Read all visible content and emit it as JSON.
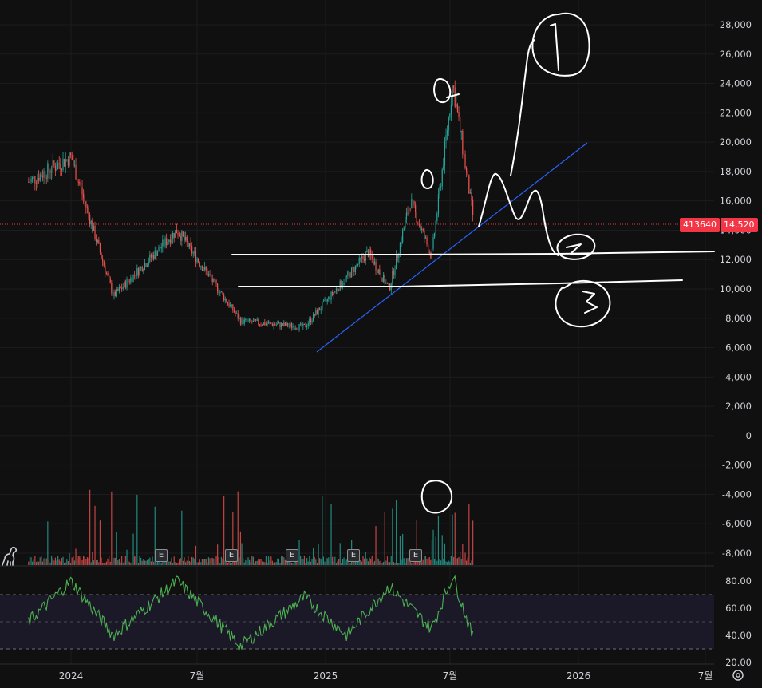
{
  "price_axis": {
    "labels": [
      "28,000",
      "26,000",
      "24,000",
      "22,000",
      "20,000",
      "18,000",
      "16,000",
      "14,000",
      "12,000",
      "10,000",
      "8,000",
      "6,000",
      "4,000",
      "2,000",
      "0",
      "-2,000",
      "-4,000",
      "-6,000",
      "-8,000"
    ],
    "values": [
      28000,
      26000,
      24000,
      22000,
      20000,
      18000,
      16000,
      14000,
      12000,
      10000,
      8000,
      6000,
      4000,
      2000,
      0,
      -2000,
      -4000,
      -6000,
      -8000
    ]
  },
  "rsi_axis": {
    "labels": [
      "80.00",
      "60.00",
      "40.00",
      "20.00"
    ],
    "values": [
      80,
      60,
      40,
      20
    ],
    "band_upper": 70,
    "band_mid": 50,
    "band_lower": 30
  },
  "time_axis": {
    "labels": [
      "2024",
      "7월",
      "2025",
      "7월",
      "2026",
      "7월"
    ]
  },
  "badges": {
    "volume_label": "413640",
    "price_label": "14,520"
  },
  "earnings_markers": [
    "E",
    "E",
    "E",
    "E",
    "E"
  ],
  "colors": {
    "background": "#101010",
    "up": "#26a69a",
    "down": "#ef5350",
    "rsi_line": "#4caf50",
    "trendline": "#2962ff",
    "annotation": "#ffffff",
    "price_badge": "#f23645"
  },
  "chart_data": {
    "type": "candlestick",
    "price_current": 14520,
    "volume_current": 413640,
    "ylim": [
      -8000,
      28000
    ],
    "key_points": [
      {
        "x": "2023-11",
        "y": 17300
      },
      {
        "x": "2024-01",
        "y": 19000
      },
      {
        "x": "2024-03",
        "y": 9500
      },
      {
        "x": "2024-06",
        "y": 14000
      },
      {
        "x": "2024-09",
        "y": 7800
      },
      {
        "x": "2024-12",
        "y": 7400
      },
      {
        "x": "2025-03",
        "y": 12500
      },
      {
        "x": "2025-04",
        "y": 10000
      },
      {
        "x": "2025-05",
        "y": 16000
      },
      {
        "x": "2025-06",
        "y": 12200
      },
      {
        "x": "2025-07",
        "y": 24000
      },
      {
        "x": "2025-08",
        "y": 14520
      }
    ],
    "rsi_ylim": [
      20,
      85
    ],
    "rsi_key_points": [
      {
        "x": "2023-11",
        "y": 50
      },
      {
        "x": "2024-01",
        "y": 80
      },
      {
        "x": "2024-03",
        "y": 40
      },
      {
        "x": "2024-06",
        "y": 80
      },
      {
        "x": "2024-09",
        "y": 32
      },
      {
        "x": "2024-12",
        "y": 68
      },
      {
        "x": "2025-02",
        "y": 40
      },
      {
        "x": "2025-04",
        "y": 76
      },
      {
        "x": "2025-06",
        "y": 45
      },
      {
        "x": "2025-07",
        "y": 84
      },
      {
        "x": "2025-08",
        "y": 36
      }
    ]
  }
}
